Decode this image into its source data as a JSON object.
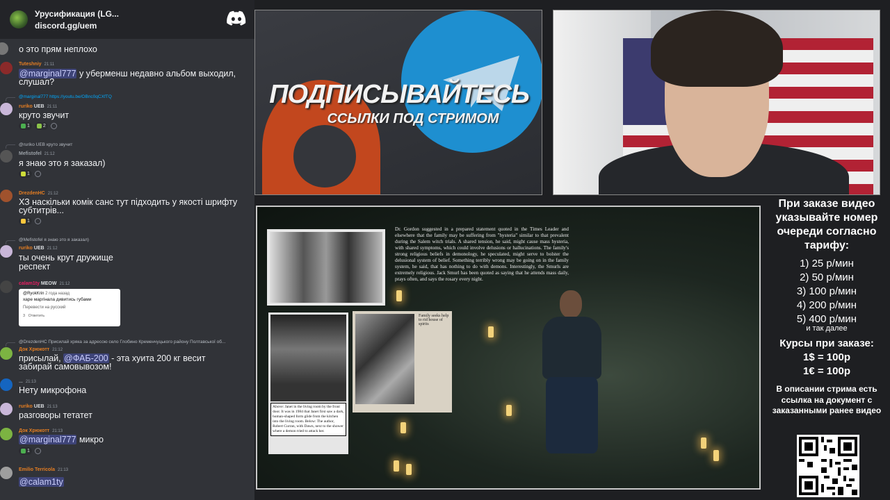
{
  "discord": {
    "server_name": "Урусификация (LG...",
    "server_link": "discord.gg/uem",
    "messages": [
      {
        "text": "о это прям неплохо"
      },
      {
        "user": "Tuteshniy",
        "time": "21:11",
        "mention": "@marginal777",
        "text": " у уберменш недавно альбом выходил,",
        "text2": "слушал?"
      },
      {
        "reply": "@marginal777 https://youtu.be/OBnc0qCXfTQ",
        "user": "ruriko",
        "badge": "UEB",
        "time": "21:11",
        "text": "круто звучит",
        "reactions": [
          "1",
          "2"
        ]
      },
      {
        "reply": "@ruriko UEB круто звучит",
        "user": "Mefistofel",
        "time": "21:12",
        "text": "я  знаю это я заказал)",
        "reactions": [
          "1"
        ]
      },
      {
        "user": "DrezdenHC",
        "time": "21:12",
        "text": "ХЗ наскільки комік санс тут підходить у якості шрифту",
        "text2": "субтитрів...",
        "reactions": [
          "1"
        ]
      },
      {
        "reply": "@Mefistofel я  знаю это я заказал)",
        "user": "ruriko",
        "badge": "UEB",
        "time": "21:12",
        "text": "ты очень крут дружище",
        "text2": "респект"
      },
      {
        "user": "calam1ty",
        "badge": "MEOW",
        "time": "21:12",
        "embed": {
          "user": "@RyokKrin",
          "time": "2 года назад",
          "text": "харе маргінала дивитись губами",
          "translate": "Перевести на русский",
          "likes": "3",
          "answer": "Ответить"
        }
      },
      {
        "reply": "@DrezdenHC Присилай хряка за адресою село Глобино Кременчуцького району Полтавської об...",
        "user": "Док Хрюкотт",
        "time": "21:12",
        "text": "присылай, ",
        "mention": "@ФАБ-200",
        "text2": "- эта хуита 200 кг весит",
        "text3": "забирай самовывозом!"
      },
      {
        "user": "...",
        "time": "21:13",
        "text": "Нету микрофона"
      },
      {
        "user": "ruriko",
        "badge": "UEB",
        "time": "21:13",
        "text": "разговоры тетатет"
      },
      {
        "user": "Док Хрюкотт",
        "time": "21:13",
        "mention": "@marginal777",
        "text": " микро",
        "reactions": [
          "1"
        ]
      },
      {
        "user": "Emilio Terricola",
        "time": "21:13",
        "mention": "@calam1ty"
      }
    ]
  },
  "banner": {
    "title": "ПОДПИСЫВАЙТЕСЬ",
    "subtitle": "ССЫЛКИ ПОД СТРИМОМ"
  },
  "video": {
    "article": "Dr. Gordon suggested in a prepared statement quoted in the Times Leader and elsewhere that the family may be suffering from \"hysteria\" similar to that prevalent during the Salem witch trials. A shared tension, he said, might cause mass hysteria, with shared symptoms, which could involve delusions or hallucinations. The family's strong religious beliefs in demonology, he speculated, might serve to bolster the delusional system of belief. Something terribly wrong may be going on in the family system, he said, that has nothing to do with demons. Interestingly, the Smurls are extremely religious. Jack Smurl has been quoted as saying that he attends mass daily, prays often, and says the rosary every night.",
    "caption": "Above: Janet in the living room by the front door. It was in 1984 that Janet first saw a dark, human-shaped form glide from the kitchen into the living room. Below: The author, Robert Curran, with Dawn, next to the shower where a demon tried to attack her.",
    "clipping_headline": "Family seeks help to rid house of spirits"
  },
  "info": {
    "header": "При заказе видео указывайте номер очереди согласно тарифу:",
    "tariffs": [
      "1) 25 р/мин",
      "2) 50 р/мин",
      "3) 100 р/мин",
      "4) 200 р/мин",
      "5) 400 р/мин"
    ],
    "etc": "и так далее",
    "courses_header": "Курсы при заказе:",
    "rates": [
      "1$ = 100р",
      "1€ = 100р"
    ],
    "description": "В описании стрима есть ссылка на документ с заказанными ранее видео"
  },
  "colors": {
    "discord_bg": "#313338",
    "mention_bg": "#5865f2",
    "telegram_blue": "#1e8fd0",
    "patreon_red": "#c2471e"
  }
}
